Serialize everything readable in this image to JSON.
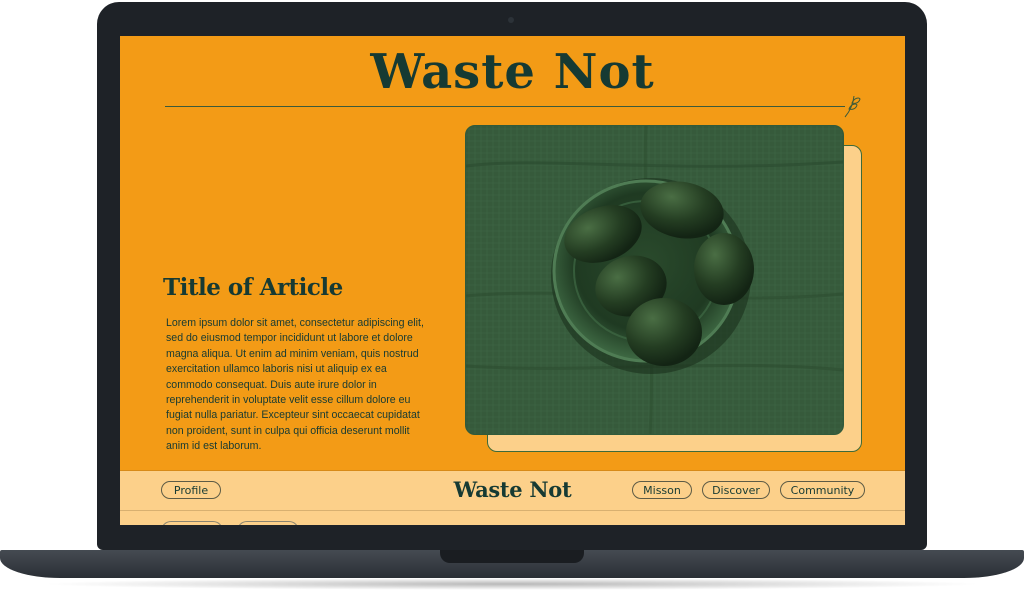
{
  "site": {
    "hero_title": "Waste Not",
    "article_title": "Title of Article",
    "article_body": "Lorem ipsum dolor sit amet, consectetur adipiscing elit, sed do eiusmod tempor incididunt ut labore et dolore magna aliqua. Ut enim ad minim veniam, quis nostrud exercitation ullamco laboris nisi ut aliquip ex ea commodo consequat. Duis aute irure dolor in reprehenderit in voluptate velit esse cillum dolore eu fugiat nulla pariatur. Excepteur sint occaecat cupidatat non proident, sunt in culpa qui officia deserunt mollit anim id est laborum."
  },
  "nav": {
    "brand": "Waste Not",
    "profile_label": "Profile",
    "links": [
      "Misson",
      "Discover",
      "Community"
    ]
  },
  "colors": {
    "page_background": "#f39b16",
    "nav_background": "#fcd08a",
    "text_dark_green": "#163a33"
  },
  "icons": {
    "leaf": "leaf-sprig-icon"
  },
  "image": {
    "subject": "avocados in a green bowl on linen"
  }
}
